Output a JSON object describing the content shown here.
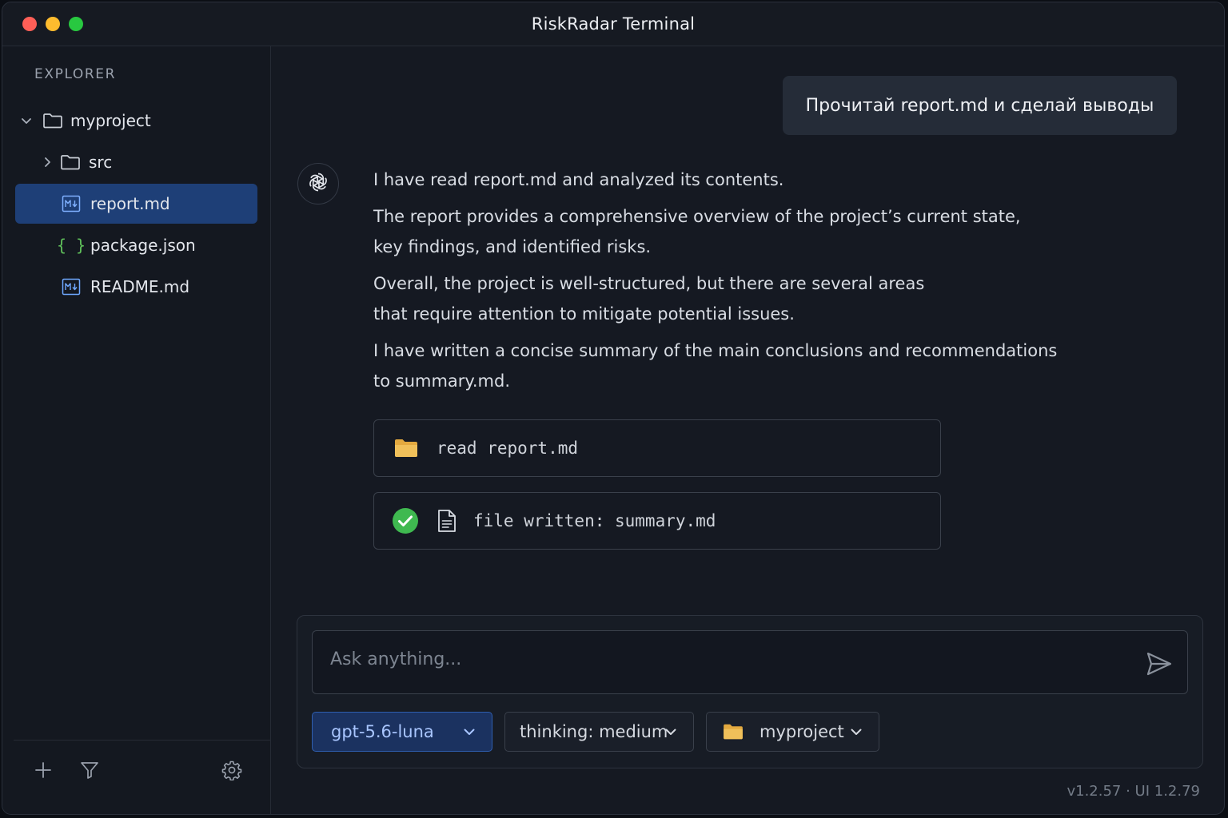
{
  "window": {
    "title": "RiskRadar Terminal"
  },
  "sidebar": {
    "heading": "EXPLORER",
    "tree": {
      "root": {
        "label": "myproject",
        "expanded": true
      },
      "items": [
        {
          "label": "src",
          "type": "folder",
          "expanded": false
        },
        {
          "label": "report.md",
          "type": "markdown",
          "selected": true
        },
        {
          "label": "package.json",
          "type": "json"
        },
        {
          "label": "README.md",
          "type": "markdown"
        }
      ]
    },
    "footer_icons": [
      "plus-icon",
      "filter-icon",
      "gear-icon"
    ]
  },
  "chat": {
    "user_message": "Прочитай report.md и сделай выводы",
    "assistant_paragraphs": [
      "I have read report.md and analyzed its contents.",
      "The report provides a comprehensive overview of the project’s current state, key findings, and identified risks.",
      "Overall, the project is well-structured, but there are several areas that require attention to mitigate potential issues.",
      "I have written a concise summary of the main conclusions and recommendations to summary.md."
    ],
    "tool_calls": [
      {
        "text": "read report.md",
        "icon": "folder-icon"
      },
      {
        "text": "file written: summary.md",
        "icon": "file-icon",
        "status": "success"
      }
    ]
  },
  "composer": {
    "placeholder": "Ask anything...",
    "value": "",
    "model": "gpt-5.6-luna",
    "thinking": "thinking: medium",
    "project": "myproject"
  },
  "footer": {
    "version": "v1.2.57 · UI 1.2.79"
  },
  "colors": {
    "background": "#151922",
    "selection": "#1e3f77",
    "accent": "#2f5fb0",
    "success": "#3fb950",
    "folder": "#e8b64c",
    "json": "#5fbf5a",
    "markdown_icon": "#6fa8ff"
  }
}
